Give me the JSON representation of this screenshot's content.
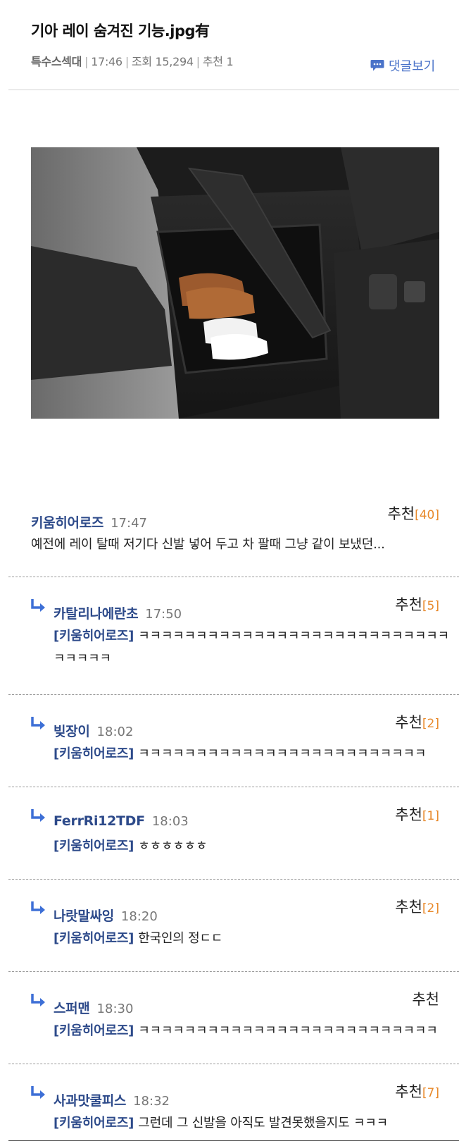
{
  "post": {
    "title": "기아 레이 숨겨진 기능.jpg有",
    "author": "특수스섹대",
    "time": "17:46",
    "views_label": "조회 15,294",
    "recommend_label": "추천 1",
    "comment_view_label": "댓글보기"
  },
  "comments": [
    {
      "nick": "키움히어로즈",
      "time": "17:47",
      "rec_label": "추천",
      "rec_count": "[40]",
      "mention": "",
      "text": "예전에 레이 탈때 저기다 신발 넣어 두고 차 팔때 그냥 같이 보냈던...",
      "text2": ""
    },
    {
      "nick": "카탈리나에란초",
      "time": "17:50",
      "rec_label": "추천",
      "rec_count": "[5]",
      "mention": "[키움히어로즈]",
      "text": "ㅋㅋㅋㅋㅋㅋㅋㅋㅋㅋㅋㅋㅋㅋㅋㅋㅋㅋㅋㅋㅋㅋㅋㅋㅋㅋㅋ",
      "text2": "ㅋㅋㅋㅋㅋ"
    },
    {
      "nick": "빚장이",
      "time": "18:02",
      "rec_label": "추천",
      "rec_count": "[2]",
      "mention": "[키움히어로즈]",
      "text": "ㅋㅋㅋㅋㅋㅋㅋㅋㅋㅋㅋㅋㅋㅋㅋㅋㅋㅋㅋㅋㅋㅋㅋㅋㅋ",
      "text2": ""
    },
    {
      "nick": "FerrRi12TDF",
      "time": "18:03",
      "rec_label": "추천",
      "rec_count": "[1]",
      "mention": "[키움히어로즈]",
      "text": "ㅎㅎㅎㅎㅎㅎ",
      "text2": ""
    },
    {
      "nick": "나랏말싸잉",
      "time": "18:20",
      "rec_label": "추천",
      "rec_count": "[2]",
      "mention": "[키움히어로즈]",
      "text": "한국인의 정ㄷㄷ",
      "text2": ""
    },
    {
      "nick": "스퍼맨",
      "time": "18:30",
      "rec_label": "추천",
      "rec_count": "",
      "mention": "[키움히어로즈]",
      "text": "ㅋㅋㅋㅋㅋㅋㅋㅋㅋㅋㅋㅋㅋㅋㅋㅋㅋㅋㅋㅋㅋㅋㅋㅋㅋㅋ",
      "text2": ""
    },
    {
      "nick": "사과맛쿨피스",
      "time": "18:32",
      "rec_label": "추천",
      "rec_count": "[7]",
      "mention": "[키움히어로즈]",
      "text": "그런데 그 신발을 아직도 발견못했을지도 ㅋㅋㅋ",
      "text2": ""
    }
  ],
  "icons": {
    "comment_bubble": "speech-bubble-icon",
    "reply": "reply-arrow-icon"
  },
  "colors": {
    "nick": "#2d4a8a",
    "rec_count": "#e8892b",
    "link": "#4a73c9"
  }
}
